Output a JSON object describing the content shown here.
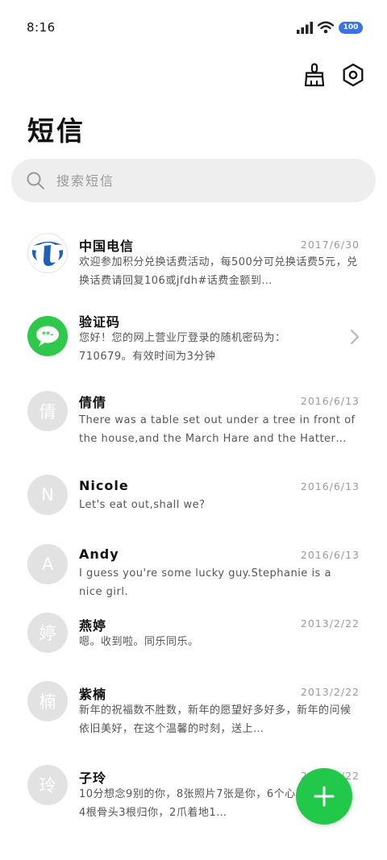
{
  "status": {
    "time": "8:16",
    "battery": "100"
  },
  "header": {
    "title": "短信"
  },
  "search": {
    "placeholder": "搜索短信"
  },
  "conversations": [
    {
      "name": "中国电信",
      "date": "2017/6/30",
      "preview": "欢迎参加积分兑换话费活动，每500分可兑换话费5元，兑换话费请回复106或jfdh#话费金额到…",
      "avatar": ""
    },
    {
      "name": "验证码",
      "date": "",
      "preview": "您好！您的网上营业厅登录的随机密码为：710679。有效时间为3分钟",
      "avatar": ""
    },
    {
      "name": "倩倩",
      "date": "2016/6/13",
      "preview": "There was a table set out under a tree in front of the house,and the March Hare and the Hatter wer…",
      "avatar": "倩"
    },
    {
      "name": "Nicole",
      "date": "2016/6/13",
      "preview": "Let's eat out,shall we?",
      "avatar": "N"
    },
    {
      "name": "Andy",
      "date": "2016/6/13",
      "preview": "I guess you're some lucky guy.Stephanie is a nice girl.",
      "avatar": "A"
    },
    {
      "name": "燕婷",
      "date": "2013/2/22",
      "preview": "嗯。收到啦。同乐同乐。",
      "avatar": "婷"
    },
    {
      "name": "紫楠",
      "date": "2013/2/22",
      "preview": "新年的祝福数不胜数，新年的愿望好多好多，新年的问候依旧美好，在这个温馨的时刻，送上…",
      "avatar": "楠"
    },
    {
      "name": "子玲",
      "date": "2013/2/22",
      "preview": "10分想念9别的你，8张照片7张是你，6个心愿5只像你，4根骨头3根归你，2爪着地1…",
      "avatar": "玲"
    }
  ],
  "colors": {
    "accent": "#22c84a",
    "avatar_gray": "#e2e2e2",
    "telecom_blue": "#1f5fb8"
  }
}
